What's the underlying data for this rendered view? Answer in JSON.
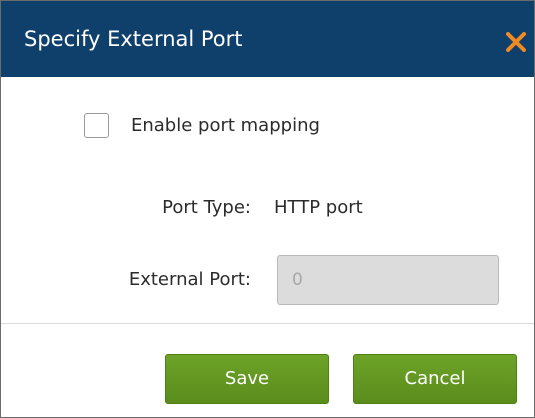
{
  "dialog": {
    "title": "Specify External Port",
    "close_icon": "close-x-icon"
  },
  "form": {
    "enable_mapping": {
      "label": "Enable port mapping",
      "checked": false
    },
    "port_type": {
      "label": "Port Type:",
      "value": "HTTP port"
    },
    "external_port": {
      "label": "External Port:",
      "value": "0",
      "disabled": true
    }
  },
  "buttons": {
    "save_label": "Save",
    "cancel_label": "Cancel"
  },
  "colors": {
    "titlebar": "#0f3f6b",
    "close_icon": "#f08a24",
    "button": "#66a02a"
  }
}
